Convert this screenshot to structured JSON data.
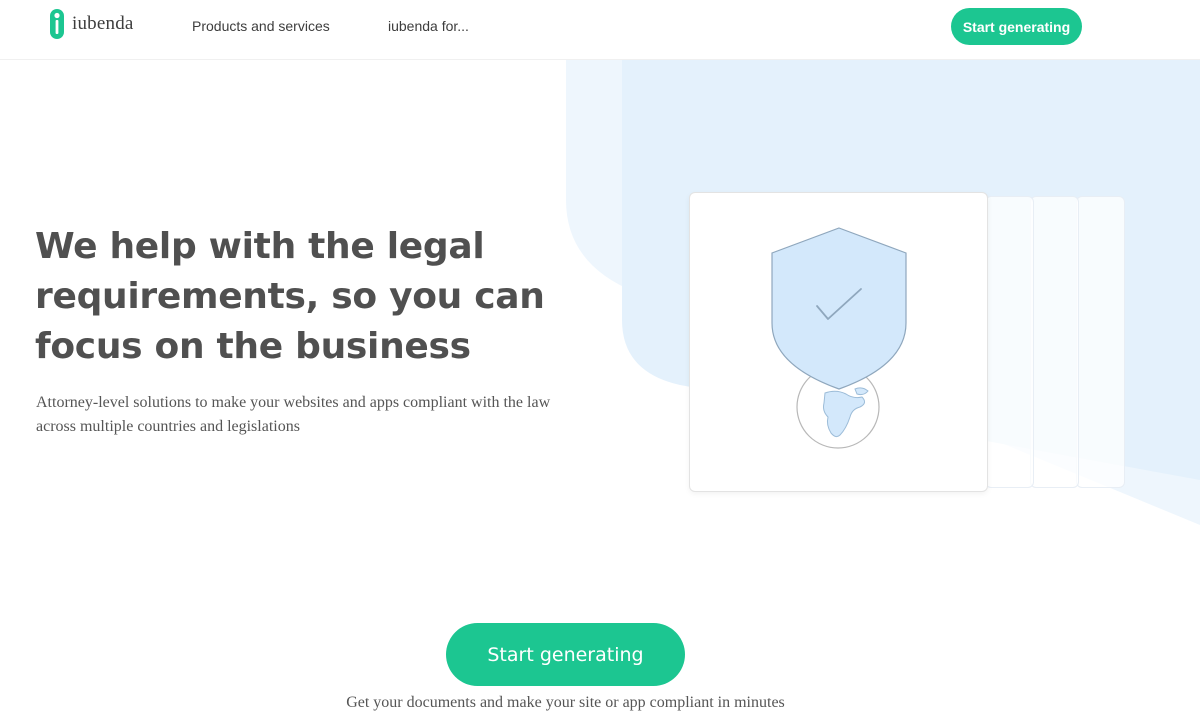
{
  "header": {
    "logo_text": "iubenda",
    "nav": [
      {
        "label": "Products and services"
      },
      {
        "label": "iubenda for..."
      }
    ],
    "cta_label": "Start generating"
  },
  "hero": {
    "title": "We help with the legal requirements, so you can focus on the business",
    "subtitle": "Attorney-level solutions to make your websites and apps compliant with the law across multiple countries and legislations"
  },
  "illustration": {
    "icons": [
      "shield-check-icon",
      "globe-icon"
    ]
  },
  "main_cta": {
    "label": "Start generating",
    "caption": "Get your documents and make your site or app compliant in minutes"
  },
  "colors": {
    "accent": "#1cc691",
    "backdrop_light": "#eef6fd",
    "backdrop": "#e4f1fc",
    "shield_fill": "#d3e8fb",
    "title_text": "#505050",
    "body_text": "#555555"
  }
}
